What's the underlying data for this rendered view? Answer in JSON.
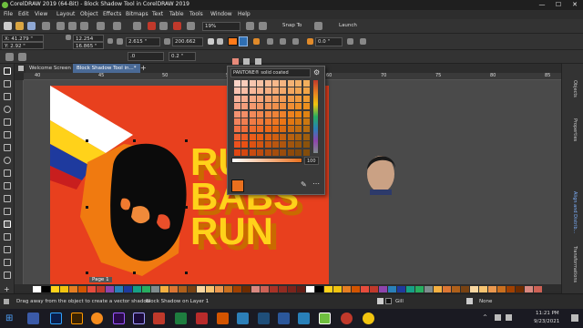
{
  "window": {
    "title": "CorelDRAW 2019 (64-Bit) - Block Shadow Tool in CorelDRAW 2019",
    "minimize": "—",
    "maximize": "☐",
    "close": "✕"
  },
  "menu": [
    "File",
    "Edit",
    "View",
    "Layout",
    "Object",
    "Effects",
    "Bitmaps",
    "Text",
    "Table",
    "Tools",
    "Window",
    "Help"
  ],
  "toolbar1": {
    "zoom": "19%",
    "snap_to": "Snap To",
    "launch": "Launch"
  },
  "toolbar2": {
    "x": "X: 41.279 \"",
    "y": "Y: 2.92 \"",
    "w": "12.254",
    "h": "16.865 \"",
    "depth": "2.615 \"",
    "direction": "200.662",
    "width_value": "0.0 \"",
    "accent_color": "#ff7a1a"
  },
  "toolbar3": {
    "value1": ".0",
    "value2": "0.2 \""
  },
  "tabs": [
    {
      "label": "Welcome Screen",
      "active": false
    },
    {
      "label": "Block Shadow Tool in...*",
      "active": true
    }
  ],
  "ruler_labels": [
    "40",
    "45",
    "50",
    "55",
    "60",
    "70",
    "75",
    "80",
    "85"
  ],
  "color_popup": {
    "palette_name": "PANTONE® solid coated",
    "value": "100",
    "selected_color": "#e9701e"
  },
  "artwork": {
    "headline_lines": [
      "RU",
      "BABS",
      "RUN"
    ],
    "headline_color": "#ffd21a",
    "shadow_color": "#c96a00",
    "bg_color": "#e8401e"
  },
  "docker_tabs": [
    "Objects",
    "Properties",
    "Align and Distrib...",
    "Transformations"
  ],
  "page": {
    "label": "Page 1"
  },
  "status": {
    "hint": "Drag away from the object to create a vector shadow",
    "object_info": "Block Shadow on Layer 1",
    "fill_label": "Gill",
    "outline_label": "None",
    "fill_icon": "fill-bucket-icon",
    "outline_icon": "pen-icon"
  },
  "taskbar": {
    "time": "11:21 PM",
    "date": "9/23/2021"
  }
}
